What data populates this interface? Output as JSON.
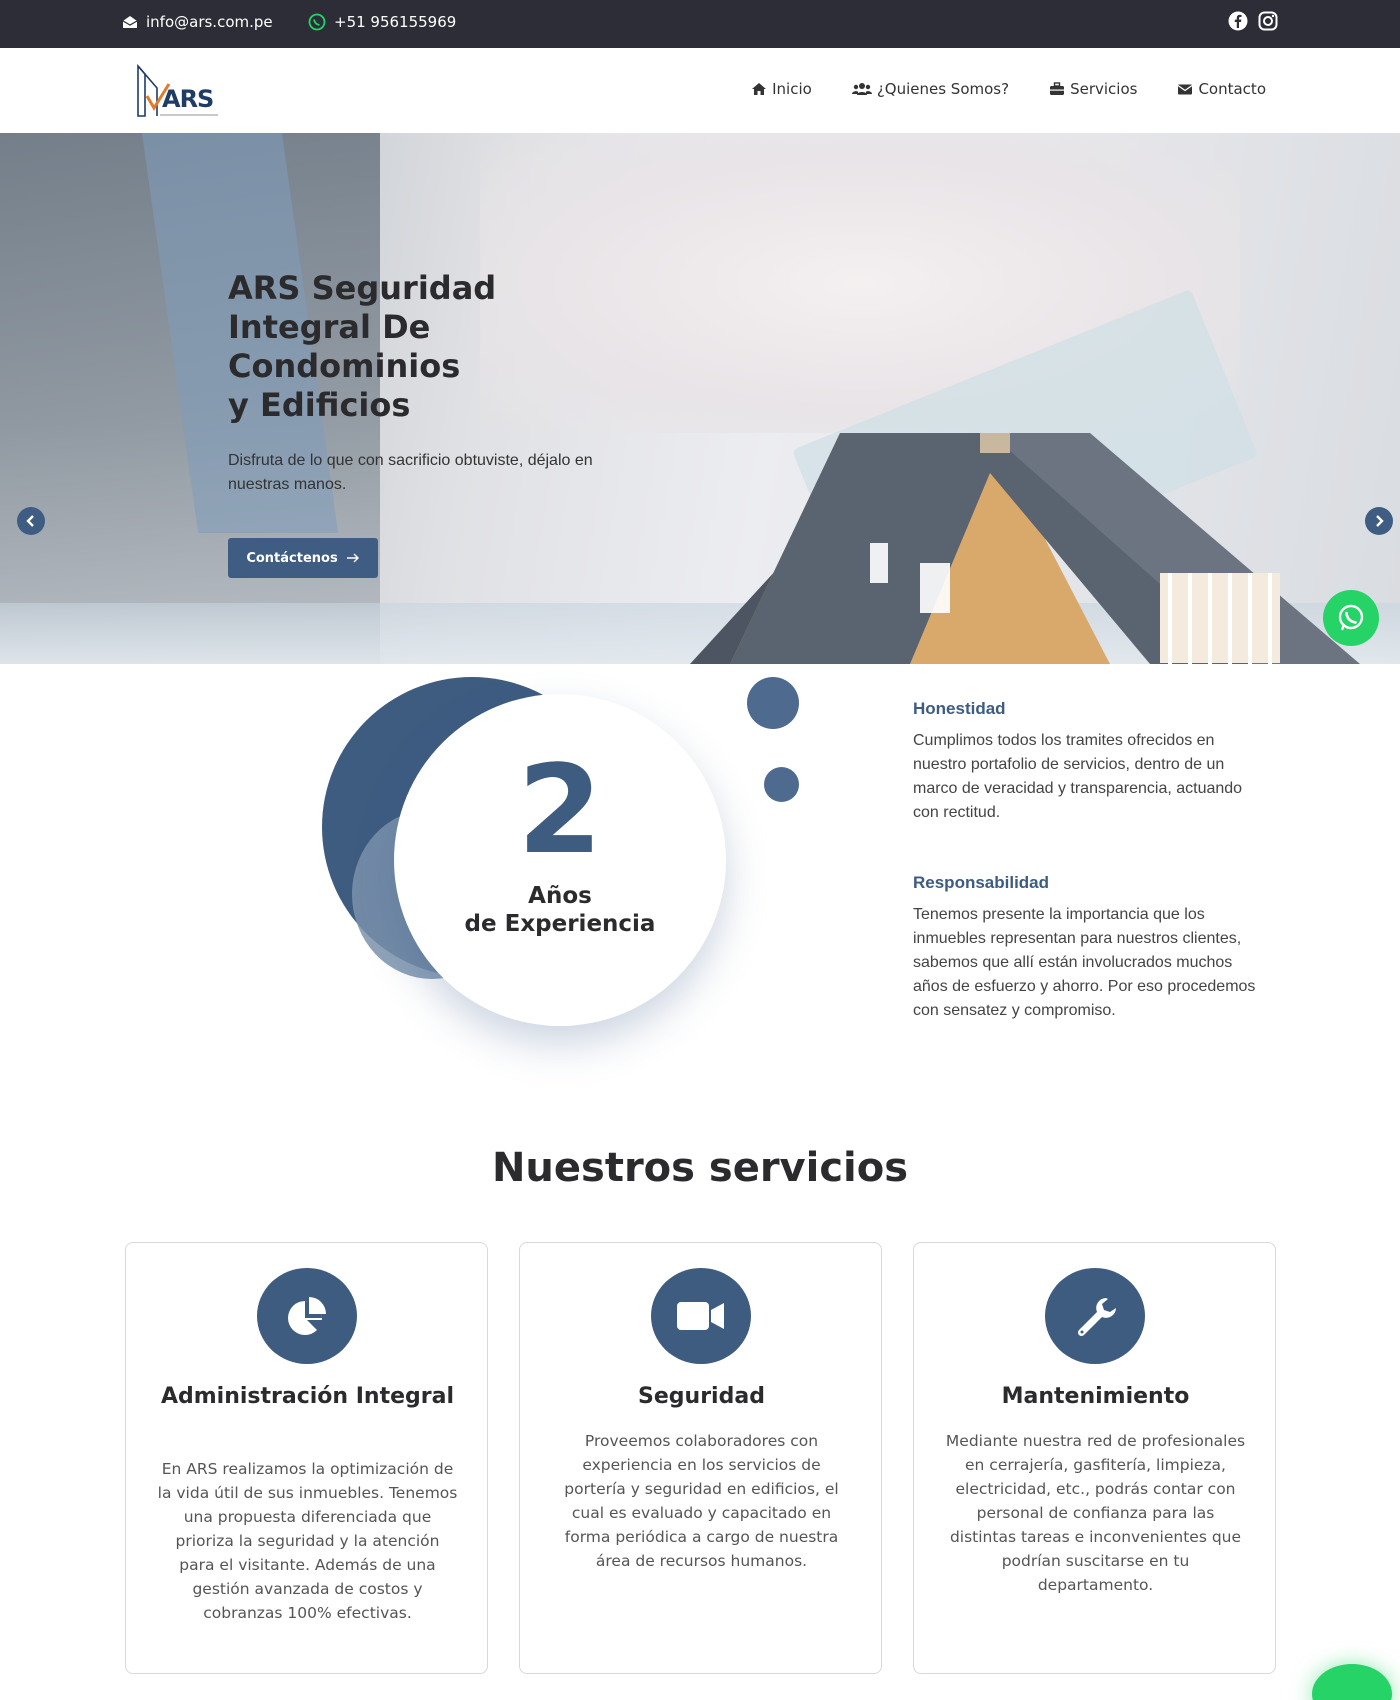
{
  "topbar": {
    "email": "info@ars.com.pe",
    "phone": "+51 956155969"
  },
  "brand": {
    "logo_text": "ARS"
  },
  "nav": {
    "items": [
      {
        "label": "Inicio",
        "icon": "home-icon"
      },
      {
        "label": "¿Quienes Somos?",
        "icon": "users-icon"
      },
      {
        "label": "Servicios",
        "icon": "briefcase-icon"
      },
      {
        "label": "Contacto",
        "icon": "envelope-icon"
      }
    ]
  },
  "hero": {
    "title_lines": [
      "ARS Seguridad",
      "Integral De",
      "Condominios",
      "y Edificios"
    ],
    "subtitle": "Disfruta de lo que con sacrificio obtuviste, déjalo en nuestras manos.",
    "cta_label": "Contáctenos"
  },
  "experience": {
    "number": "2",
    "label_line1": "Años",
    "label_line2": "de Experiencia"
  },
  "values": [
    {
      "title": "Honestidad",
      "text": "Cumplimos todos los tramites ofrecidos en nuestro portafolio de servicios, dentro de un marco de veracidad y transparencia, actuando con rectitud."
    },
    {
      "title": "Responsabilidad",
      "text": "Tenemos presente la importancia que los inmuebles representan para nuestros clientes, sabemos que allí están involucrados muchos años de esfuerzo y ahorro. Por eso procedemos con sensatez y compromiso."
    }
  ],
  "services": {
    "title": "Nuestros servicios",
    "cards": [
      {
        "title": "Administración Integral",
        "icon": "pie-chart-icon",
        "text": "En ARS realizamos la optimización de la vida útil de sus inmuebles. Tenemos una propuesta diferenciada que prioriza la seguridad y la atención para el visitante. Además de una gestión avanzada de costos y cobranzas 100% efectivas."
      },
      {
        "title": "Seguridad",
        "icon": "video-camera-icon",
        "text": "Proveemos colaboradores con experiencia en los servicios de portería y seguridad en edificios, el cual es evaluado y capacitado en forma periódica a cargo de nuestra área de recursos humanos."
      },
      {
        "title": "Mantenimiento",
        "icon": "wrench-icon",
        "text": "Mediante nuestra red de profesionales en cerrajería, gasfitería, limpieza, electricidad, etc., podrás contar con personal de confianza para las distintas tareas e inconvenientes que podrían suscitarse en tu departamento."
      }
    ]
  },
  "colors": {
    "primary": "#3e5b80",
    "topbar": "#2c2d36",
    "whatsapp": "#25d366"
  }
}
